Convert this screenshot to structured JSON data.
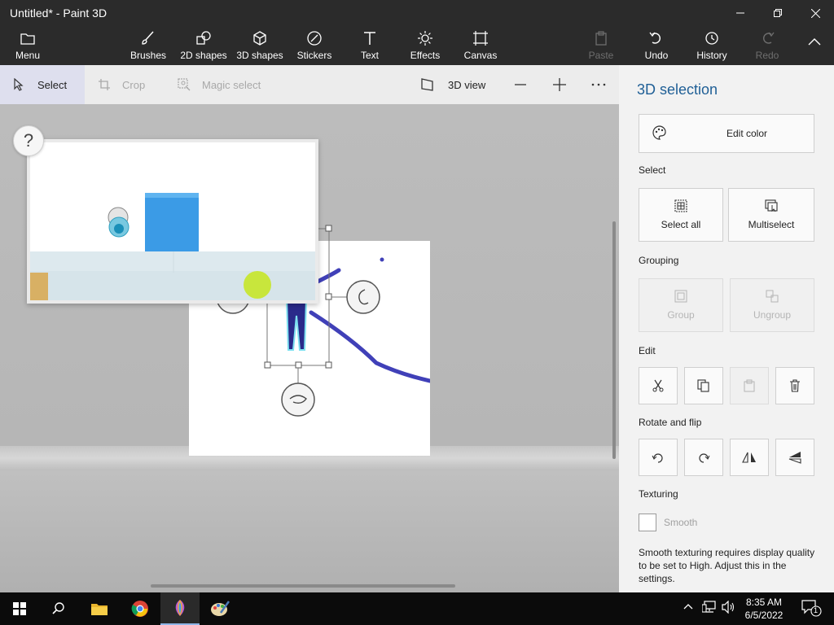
{
  "window": {
    "title": "Untitled* - Paint 3D"
  },
  "toolbar": {
    "menu": "Menu",
    "brushes": "Brushes",
    "shapes2d": "2D shapes",
    "shapes3d": "3D shapes",
    "stickers": "Stickers",
    "text": "Text",
    "effects": "Effects",
    "canvas": "Canvas",
    "paste": "Paste",
    "undo": "Undo",
    "history": "History",
    "redo": "Redo"
  },
  "subtoolbar": {
    "select": "Select",
    "crop": "Crop",
    "magic_select": "Magic select",
    "view3d": "3D view",
    "zoom_out": "—",
    "zoom_in": "+",
    "more": "···"
  },
  "canvas": {
    "help": "?"
  },
  "panel": {
    "title": "3D selection",
    "edit_color": "Edit color",
    "select_heading": "Select",
    "select_all": "Select all",
    "multiselect": "Multiselect",
    "grouping_heading": "Grouping",
    "group": "Group",
    "ungroup": "Ungroup",
    "edit_heading": "Edit",
    "rotate_heading": "Rotate and flip",
    "texturing_heading": "Texturing",
    "smooth": "Smooth",
    "smooth_checked": false,
    "smooth_note": "Smooth texturing requires display quality to be set to High. Adjust this in the settings."
  },
  "taskbar": {
    "time": "8:35 AM",
    "date": "6/5/2022",
    "notifications": "1"
  },
  "colors": {
    "accent": "#1f5f96",
    "brush_stroke": "#4040b8",
    "cube": "#3b9be6",
    "ball": "#c8e63c"
  }
}
